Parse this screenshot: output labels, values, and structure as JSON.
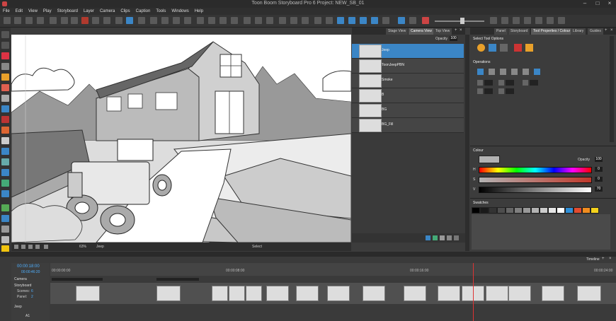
{
  "app": {
    "title": "Toon Boom Storyboard Pro 6 Project: NEW_SB_01"
  },
  "menu": [
    "File",
    "Edit",
    "View",
    "Play",
    "Storyboard",
    "Layer",
    "Camera",
    "Clips",
    "Caption",
    "Tools",
    "Windows",
    "Help"
  ],
  "view_tabs": {
    "stage": "Stage View",
    "camera": "Camera View",
    "top": "Top View"
  },
  "layers_panel": {
    "opacity_label": "Opacity",
    "opacity_value": "100",
    "layers": [
      {
        "name": "Jeep"
      },
      {
        "name": "ToonJeepPBN"
      },
      {
        "name": "Smoke"
      },
      {
        "name": "B"
      },
      {
        "name": "BG"
      },
      {
        "name": "BG_Fill"
      }
    ]
  },
  "canvas_bar": {
    "zoom": "63%",
    "layer": "Jeep",
    "mode": "Select"
  },
  "right_tabs": {
    "panel": "Panel",
    "storyboard": "Storyboard",
    "tool_props": "Tool Properties / Colour",
    "library": "Library",
    "guides": "Guides"
  },
  "tool_options": {
    "section": "Select Tool Options",
    "operations": "Operations"
  },
  "colour": {
    "title": "Colour",
    "opacity_label": "Opacity",
    "opacity_value": "100",
    "h_label": "H",
    "h_value": "0",
    "s_label": "S",
    "s_value": "0",
    "v_label": "V",
    "v_value": "70",
    "swatch_hex": "#b2b2b2"
  },
  "swatches": {
    "title": "Swatches",
    "colors": [
      "#000000",
      "#1a1a1a",
      "#333333",
      "#4d4d4d",
      "#666666",
      "#808080",
      "#999999",
      "#b3b3b3",
      "#cccccc",
      "#e6e6e6",
      "#ffffff",
      "#2f8fd8",
      "#e24b2f",
      "#f08c1f",
      "#f4d21c"
    ]
  },
  "timeline": {
    "title": "Timeline",
    "timecode": "00:00:18:00",
    "timecode_sub": "00:00:46:20",
    "ruler_marks": [
      "00:00:00:00",
      "00:00:08:00",
      "00:00:16:00",
      "00:00:24:00"
    ],
    "tracks": {
      "camera": "Camera",
      "storyboard": "Storyboard",
      "audio": "Jeep",
      "audio_a": "A1"
    },
    "scenes_label": "Scenes:",
    "scenes_value": "6",
    "panels_label": "Panel:",
    "panels_value": "2"
  }
}
